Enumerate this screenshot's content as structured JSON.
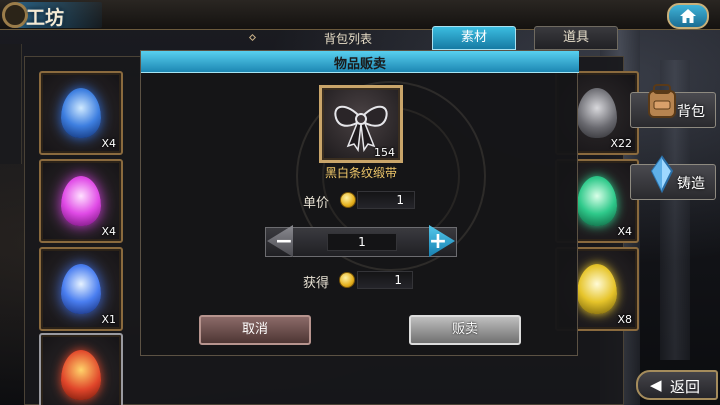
{
  "window": {
    "title": "工坊"
  },
  "tabs": {
    "list_title": "背包列表",
    "items": [
      {
        "label": "素材",
        "active": true
      },
      {
        "label": "道具",
        "active": false
      }
    ]
  },
  "inventory": {
    "left_column": [
      {
        "icon": "blue-crystal-icon",
        "count": "X4"
      },
      {
        "icon": "magenta-crystal-icon",
        "count": "X4"
      },
      {
        "icon": "blue-flame-crystal-icon",
        "count": "X1"
      },
      {
        "icon": "red-ember-crystal-icon",
        "count": ""
      }
    ],
    "right_column": [
      {
        "icon": "ribbon-item-icon",
        "count": "X22"
      },
      {
        "icon": "green-crystal-icon",
        "count": "X4"
      },
      {
        "icon": "yellow-crystal-icon",
        "count": "X8"
      }
    ]
  },
  "side": {
    "bag_label": "背包",
    "forge_label": "铸造",
    "back_label": "返回"
  },
  "modal": {
    "title": "物品贩卖",
    "item": {
      "name": "黑白条纹缎带",
      "count": "154",
      "icon": "black-white-ribbon-icon"
    },
    "unit_price_label": "单价",
    "unit_price_value": "1",
    "quantity": "1",
    "gain_label": "获得",
    "gain_value": "1",
    "cancel_label": "取消",
    "sell_label": "贩卖"
  },
  "colors": {
    "accent": "#2ea5d2",
    "gold": "#f0c86a",
    "frame": "#c9a56a"
  }
}
